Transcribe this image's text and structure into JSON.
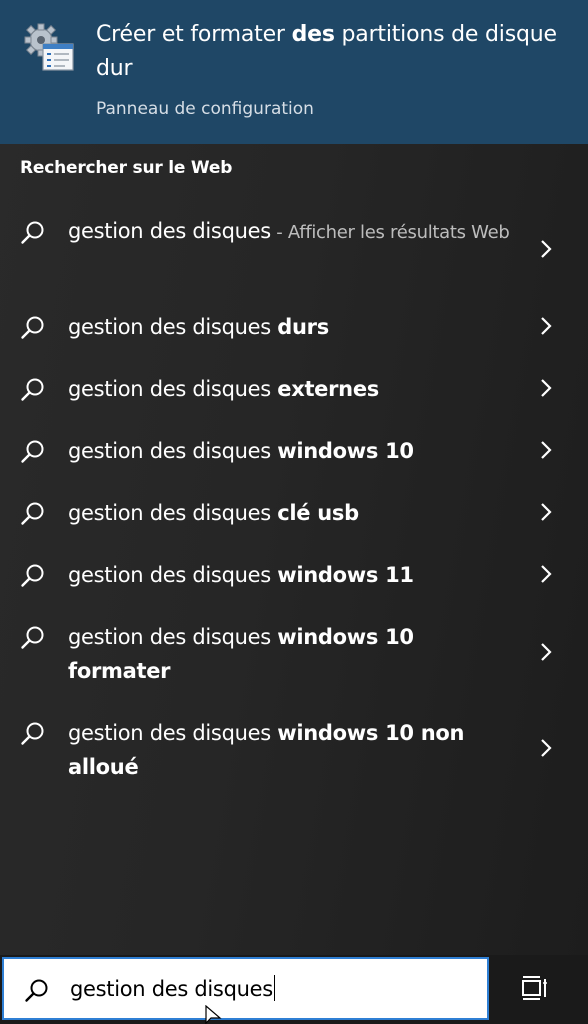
{
  "best_match": {
    "icon": "disk-management-icon",
    "title_pre": "Créer et formater ",
    "title_bold": "des",
    "title_post": " partitions de disque dur",
    "subtitle": "Panneau de configuration"
  },
  "web": {
    "header": "Rechercher sur le Web",
    "items": [
      {
        "normal": "gestion des disques",
        "bold": "",
        "dim": " - Afficher les résultats Web"
      },
      {
        "normal": "gestion des disques ",
        "bold": "durs",
        "dim": ""
      },
      {
        "normal": "gestion des disques ",
        "bold": "externes",
        "dim": ""
      },
      {
        "normal": "gestion des disques ",
        "bold": "windows 10",
        "dim": ""
      },
      {
        "normal": "gestion des disques ",
        "bold": "clé usb",
        "dim": ""
      },
      {
        "normal": "gestion des disques ",
        "bold": "windows 11",
        "dim": ""
      },
      {
        "normal": "gestion des disques ",
        "bold": "windows 10 formater",
        "dim": ""
      },
      {
        "normal": "gestion des disques ",
        "bold": "windows 10 non alloué",
        "dim": ""
      }
    ]
  },
  "search": {
    "query": "gestion des disques",
    "icon": "search-icon"
  },
  "taskbar": {
    "task_view_icon": "task-view-icon"
  },
  "colors": {
    "best_match_bg": "#1f4766",
    "panel_bg": "#262626",
    "search_border": "#2f7fd4"
  }
}
